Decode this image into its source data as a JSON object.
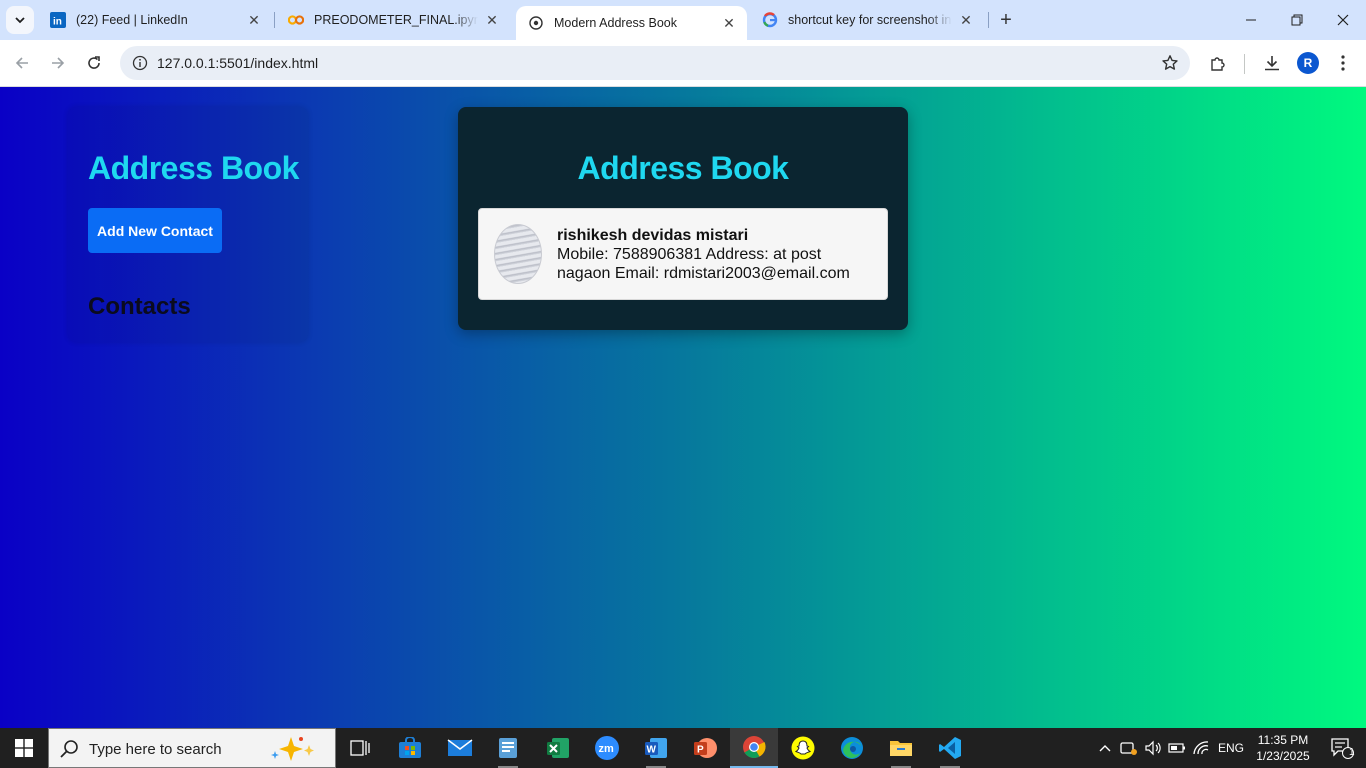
{
  "browser": {
    "tabs": [
      {
        "title": "(22) Feed | LinkedIn",
        "icon": "linkedin-icon"
      },
      {
        "title": "PREODOMETER_FINAL.ipynb - Colab",
        "icon": "colab-icon"
      },
      {
        "title": "Modern Address Book",
        "icon": "globe-icon",
        "active": true
      },
      {
        "title": "shortcut key for screenshot in windows",
        "icon": "google-icon"
      }
    ],
    "url": "127.0.0.1:5501/index.html",
    "profile_initial": "R"
  },
  "page": {
    "sidebar": {
      "title": "Address Book",
      "add_button": "Add New Contact",
      "contacts_heading": "Contacts"
    },
    "main": {
      "title": "Address Book",
      "contacts": [
        {
          "name": "rishikesh devidas mistari",
          "details": "Mobile: 7588906381 Address: at post nagaon Email: rdmistari2003@email.com"
        }
      ]
    },
    "colors": {
      "gradient_start": "#0a00c6",
      "gradient_end": "#00f97f",
      "title_color": "#1fd8f0",
      "button_color": "#0a6cf5",
      "panel_bg": "#0b2530"
    }
  },
  "taskbar": {
    "search_placeholder": "Type here to search",
    "language": "ENG",
    "time": "11:35 PM",
    "date": "1/23/2025",
    "notification_count": "1"
  }
}
